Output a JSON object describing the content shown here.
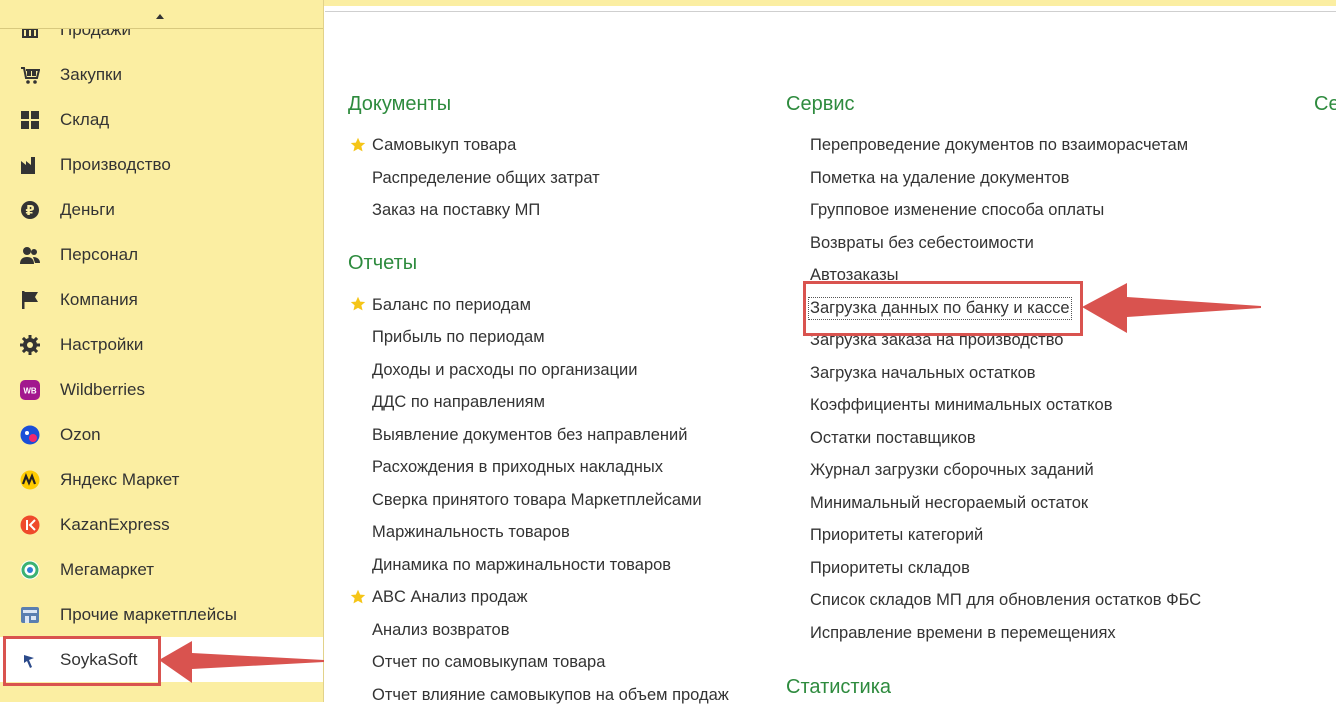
{
  "sidebar": {
    "items": [
      {
        "label": "Продажи",
        "icon": "sales-icon"
      },
      {
        "label": "Закупки",
        "icon": "cart-icon"
      },
      {
        "label": "Склад",
        "icon": "warehouse-grid-icon"
      },
      {
        "label": "Производство",
        "icon": "factory-icon"
      },
      {
        "label": "Деньги",
        "icon": "ruble-coin-icon"
      },
      {
        "label": "Персонал",
        "icon": "people-icon"
      },
      {
        "label": "Компания",
        "icon": "flag-icon"
      },
      {
        "label": "Настройки",
        "icon": "gear-icon"
      },
      {
        "label": "Wildberries",
        "icon": "wildberries-logo-icon",
        "badge": "WB"
      },
      {
        "label": "Ozon",
        "icon": "ozon-logo-icon"
      },
      {
        "label": "Яндекс Маркет",
        "icon": "yandex-market-logo-icon"
      },
      {
        "label": "KazanExpress",
        "icon": "kazanexpress-logo-icon"
      },
      {
        "label": "Мегамаркет",
        "icon": "megamarket-logo-icon"
      },
      {
        "label": "Прочие маркетплейсы",
        "icon": "marketplace-store-icon"
      },
      {
        "label": "SoykaSoft",
        "icon": "soykasoft-logo-icon"
      }
    ],
    "active_item": "SoykaSoft"
  },
  "documents": {
    "title": "Документы",
    "items": [
      {
        "label": "Самовыкуп товара",
        "favorite": true
      },
      {
        "label": "Распределение общих затрат",
        "favorite": false
      },
      {
        "label": "Заказ на поставку МП",
        "favorite": false
      }
    ]
  },
  "reports": {
    "title": "Отчеты",
    "items": [
      {
        "label": "Баланс по периодам",
        "favorite": true
      },
      {
        "label": "Прибыль по периодам",
        "favorite": false
      },
      {
        "label": "Доходы и расходы по организации",
        "favorite": false
      },
      {
        "label": "ДДС по направлениям",
        "favorite": false
      },
      {
        "label": "Выявление документов без направлений",
        "favorite": false
      },
      {
        "label": "Расхождения в приходных накладных",
        "favorite": false
      },
      {
        "label": "Сверка принятого товара Маркетплейсами",
        "favorite": false
      },
      {
        "label": "Маржинальность товаров",
        "favorite": false
      },
      {
        "label": "Динамика по маржинальности товаров",
        "favorite": false
      },
      {
        "label": "ABC Анализ продаж",
        "favorite": true
      },
      {
        "label": "Анализ возвратов",
        "favorite": false
      },
      {
        "label": "Отчет по самовыкупам товара",
        "favorite": false
      },
      {
        "label": "Отчет влияние самовыкупов на объем продаж",
        "favorite": false
      }
    ]
  },
  "service": {
    "title": "Сервис",
    "items": [
      {
        "label": "Перепроведение документов по взаиморасчетам"
      },
      {
        "label": "Пометка на удаление документов"
      },
      {
        "label": "Групповое изменение способа оплаты"
      },
      {
        "label": "Возвраты без себестоимости"
      },
      {
        "label": "Автозаказы"
      },
      {
        "label": "Загрузка данных по банку и кассе"
      },
      {
        "label": "Загрузка заказа на производство"
      },
      {
        "label": "Загрузка начальных остатков"
      },
      {
        "label": "Коэффициенты минимальных остатков"
      },
      {
        "label": "Остатки поставщиков"
      },
      {
        "label": "Журнал загрузки сборочных заданий"
      },
      {
        "label": "Минимальный несгораемый остаток"
      },
      {
        "label": "Приоритеты категорий"
      },
      {
        "label": "Приоритеты складов"
      },
      {
        "label": "Список складов МП для обновления остатков ФБС"
      },
      {
        "label": "Исправление времени в перемещениях"
      }
    ],
    "highlighted_item": "Загрузка данных по банку и кассе"
  },
  "statistics": {
    "title": "Статистика"
  },
  "third_column": {
    "title": "Се"
  },
  "colors": {
    "sidebar_bg": "#fbeea2",
    "section_title": "#2e8b3e",
    "highlight": "#d9534f",
    "star": "#f5c518"
  }
}
